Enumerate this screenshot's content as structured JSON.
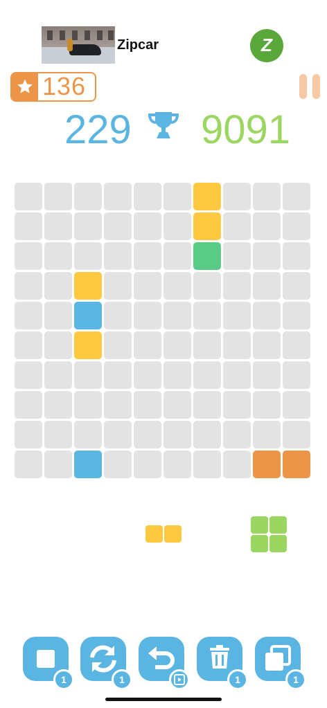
{
  "ad": {
    "title": "Zipcar",
    "logo_letter": "Z"
  },
  "stars": {
    "value": "136"
  },
  "scores": {
    "current": "229",
    "best": "9091"
  },
  "colors": {
    "yellow": "#fec940",
    "blue": "#5ab5e2",
    "green": "#59cb86",
    "orange": "#ec9447",
    "lime": "#9ad660",
    "empty": "#e3e3e3"
  },
  "board": {
    "size": 10,
    "filled": [
      {
        "r": 0,
        "c": 6,
        "color": "yellow"
      },
      {
        "r": 1,
        "c": 6,
        "color": "yellow"
      },
      {
        "r": 2,
        "c": 6,
        "color": "green"
      },
      {
        "r": 3,
        "c": 2,
        "color": "yellow"
      },
      {
        "r": 4,
        "c": 2,
        "color": "blue"
      },
      {
        "r": 5,
        "c": 2,
        "color": "yellow"
      },
      {
        "r": 9,
        "c": 2,
        "color": "blue"
      },
      {
        "r": 9,
        "c": 8,
        "color": "orange"
      },
      {
        "r": 9,
        "c": 9,
        "color": "orange"
      }
    ]
  },
  "next_pieces": [
    {
      "name": "yellow-domino",
      "color": "yellow",
      "cells": [
        [
          0,
          0
        ],
        [
          0,
          1
        ]
      ]
    },
    {
      "name": "lime-square",
      "color": "lime",
      "cells": [
        [
          0,
          0
        ],
        [
          0,
          1
        ],
        [
          1,
          0
        ],
        [
          1,
          1
        ]
      ]
    }
  ],
  "tools": [
    {
      "name": "single-block",
      "icon": "square-icon",
      "count": "1"
    },
    {
      "name": "rotate",
      "icon": "rotate-icon",
      "count": "1"
    },
    {
      "name": "undo",
      "icon": "undo-icon",
      "count": "video-icon"
    },
    {
      "name": "trash",
      "icon": "trash-icon",
      "count": "1"
    },
    {
      "name": "layers",
      "icon": "layers-icon",
      "count": "1"
    }
  ],
  "tool_badges": [
    "1",
    "1",
    "1",
    "1"
  ]
}
